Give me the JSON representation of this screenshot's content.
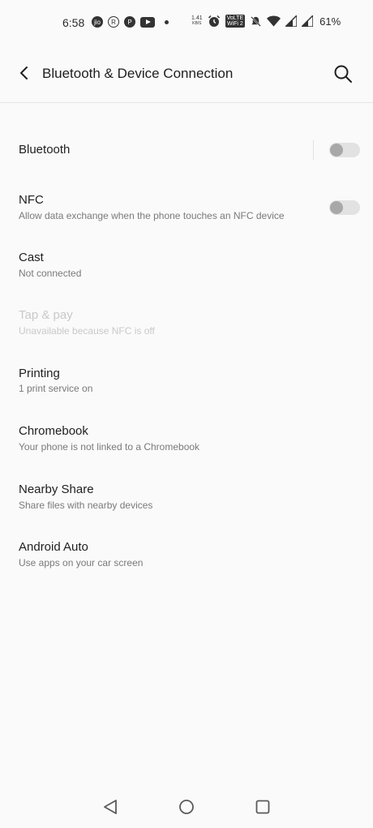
{
  "status_bar": {
    "time": "6:58",
    "speed_value": "1.41",
    "speed_unit": "KB/S",
    "volte_top": "VoLTE",
    "volte_bottom": "WiFi 2",
    "battery": "61%",
    "icons": [
      "jio-icon",
      "r-icon",
      "pinterest-icon",
      "youtube-icon",
      "dot-icon",
      "alarm-icon",
      "volte-icon",
      "mute-icon",
      "wifi-icon",
      "signal-icon",
      "signal-icon",
      "battery-icon"
    ]
  },
  "app_bar": {
    "title": "Bluetooth & Device Connection",
    "back_icon": "back-arrow-icon",
    "search_icon": "search-icon"
  },
  "items": [
    {
      "title": "Bluetooth",
      "subtitle": "",
      "toggle": false,
      "enabled": true
    },
    {
      "title": "NFC",
      "subtitle": "Allow data exchange when the phone touches an NFC device",
      "toggle": false,
      "enabled": true
    },
    {
      "title": "Cast",
      "subtitle": "Not connected",
      "enabled": true
    },
    {
      "title": "Tap & pay",
      "subtitle": "Unavailable because NFC is off",
      "enabled": false
    },
    {
      "title": "Printing",
      "subtitle": "1 print service on",
      "enabled": true
    },
    {
      "title": "Chromebook",
      "subtitle": "Your phone is not linked to a Chromebook",
      "enabled": true
    },
    {
      "title": "Nearby Share",
      "subtitle": "Share files with nearby devices",
      "enabled": true
    },
    {
      "title": "Android Auto",
      "subtitle": "Use apps on your car screen",
      "enabled": true
    }
  ],
  "nav_bar": [
    "back-triangle-icon",
    "home-circle-icon",
    "recents-square-icon"
  ]
}
